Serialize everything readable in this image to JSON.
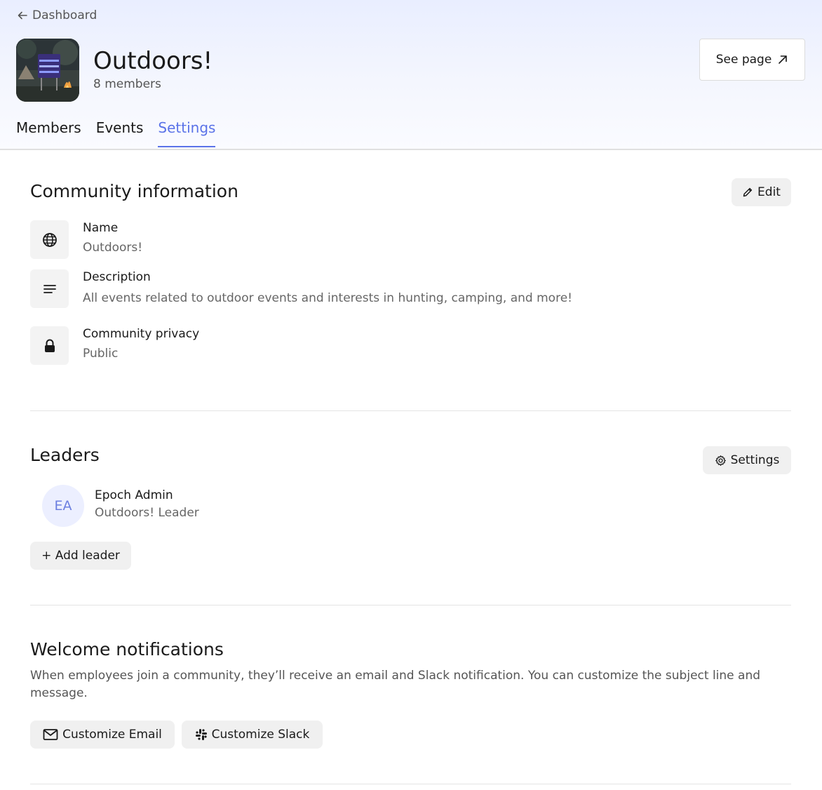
{
  "header": {
    "back_label": "Dashboard",
    "community_name": "Outdoors!",
    "member_count": "8 members",
    "see_page_label": "See page"
  },
  "tabs": [
    {
      "label": "Members",
      "active": false
    },
    {
      "label": "Events",
      "active": false
    },
    {
      "label": "Settings",
      "active": true
    }
  ],
  "community_info": {
    "title": "Community information",
    "edit_label": "Edit",
    "fields": [
      {
        "icon": "globe-icon",
        "label": "Name",
        "value": "Outdoors!"
      },
      {
        "icon": "text-lines-icon",
        "label": "Description",
        "value": "All events related to outdoor events and interests in hunting, camping, and more!"
      },
      {
        "icon": "lock-icon",
        "label": "Community privacy",
        "value": "Public"
      }
    ]
  },
  "leaders": {
    "title": "Leaders",
    "settings_label": "Settings",
    "list": [
      {
        "initials": "EA",
        "name": "Epoch Admin",
        "role": "Outdoors! Leader"
      }
    ],
    "add_label": "+ Add leader"
  },
  "welcome": {
    "title": "Welcome notifications",
    "description": "When employees join a community, they’ll receive an email and Slack notification. You can customize the subject line and message.",
    "email_label": "Customize Email",
    "slack_label": "Customize Slack"
  },
  "colors": {
    "accent": "#5b73e8",
    "button_bg": "#f0f0f0",
    "avatar_bg": "#ecefff"
  }
}
